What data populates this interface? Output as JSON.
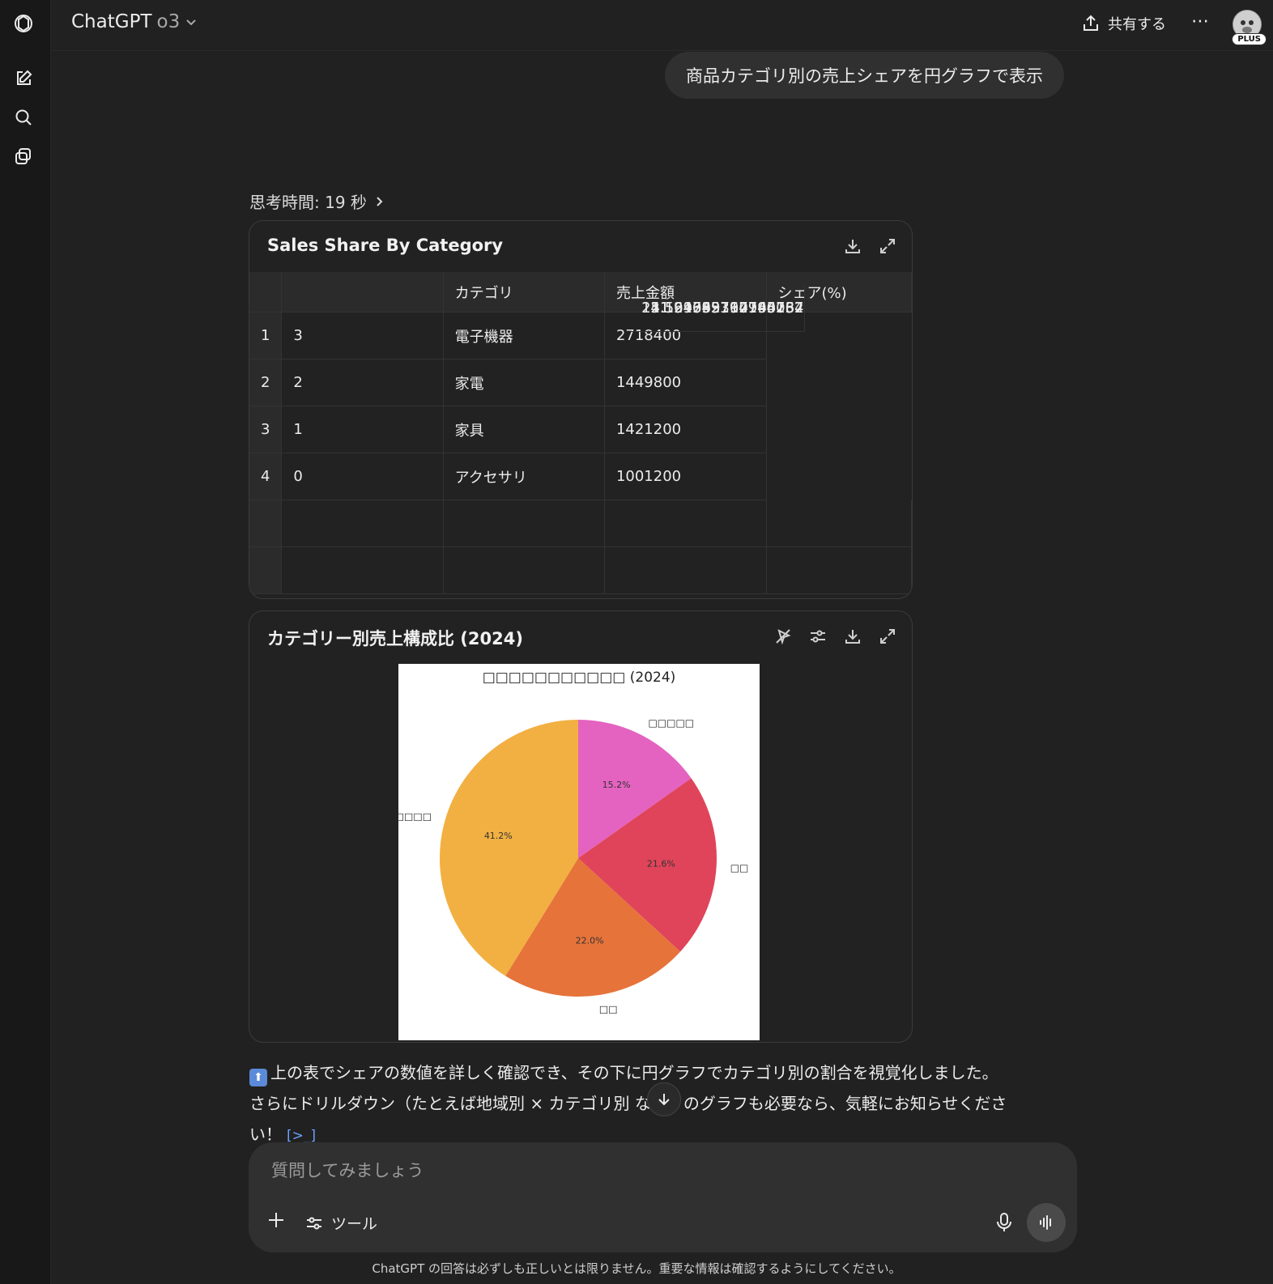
{
  "app": {
    "model_name": "ChatGPT",
    "model_version": "o3",
    "share_label": "共有する",
    "plan_badge": "PLUS"
  },
  "user_message": "商品カテゴリ別の売上シェアを円グラフで表示",
  "thinking_label": "思考時間: 19 秒",
  "table_card": {
    "title": "Sales Share By Category",
    "columns": [
      "",
      "",
      "カテゴリ",
      "売上金額",
      "シェア(%)"
    ],
    "rows": [
      {
        "idx": "1",
        "orig": "3",
        "category": "電子機器",
        "amount": "2718400",
        "share": "41.24662397960732"
      },
      {
        "idx": "2",
        "orig": "2",
        "category": "家電",
        "amount": "1449800",
        "share": "21.99799714745234"
      },
      {
        "idx": "3",
        "orig": "1",
        "category": "家具",
        "amount": "1421200",
        "share": "21.564045762146087"
      },
      {
        "idx": "4",
        "orig": "0",
        "category": "アクセサリ",
        "amount": "1001200",
        "share": "15.191333110794162"
      }
    ]
  },
  "chart_card": {
    "title": "カテゴリー別売上構成比 (2024)",
    "image_title": "□□□□□□□□□□□ (2024)"
  },
  "chart_data": {
    "type": "pie",
    "title": "□□□□□□□□□□□ (2024)",
    "start_angle_deg": 90,
    "direction": "clockwise",
    "slices": [
      {
        "label": "□□□□□",
        "value": 15.2,
        "pct_label": "15.2%",
        "color": "#e463c0"
      },
      {
        "label": "□□",
        "value": 21.6,
        "pct_label": "21.6%",
        "color": "#e0445a"
      },
      {
        "label": "□□",
        "value": 22.0,
        "pct_label": "22.0%",
        "color": "#e6733a"
      },
      {
        "label": "□□□□",
        "value": 41.2,
        "pct_label": "41.2%",
        "color": "#f2b042"
      }
    ]
  },
  "answer": {
    "emoji": "⬆",
    "line1": "上の表でシェアの数値を詳しく確認でき、その下に円グラフでカテゴリ別の割合を視覚化しました。",
    "line2": "さらにドリルダウン（たとえば地域別 × カテゴリ別 など）のグラフも必要なら、気軽にお知らせくださ",
    "line3": "い！",
    "code_ref": "[>_]"
  },
  "composer": {
    "placeholder": "質問してみましょう",
    "tools_label": "ツール"
  },
  "footer": "ChatGPT の回答は必ずしも正しいとは限りません。重要な情報は確認するようにしてください。"
}
